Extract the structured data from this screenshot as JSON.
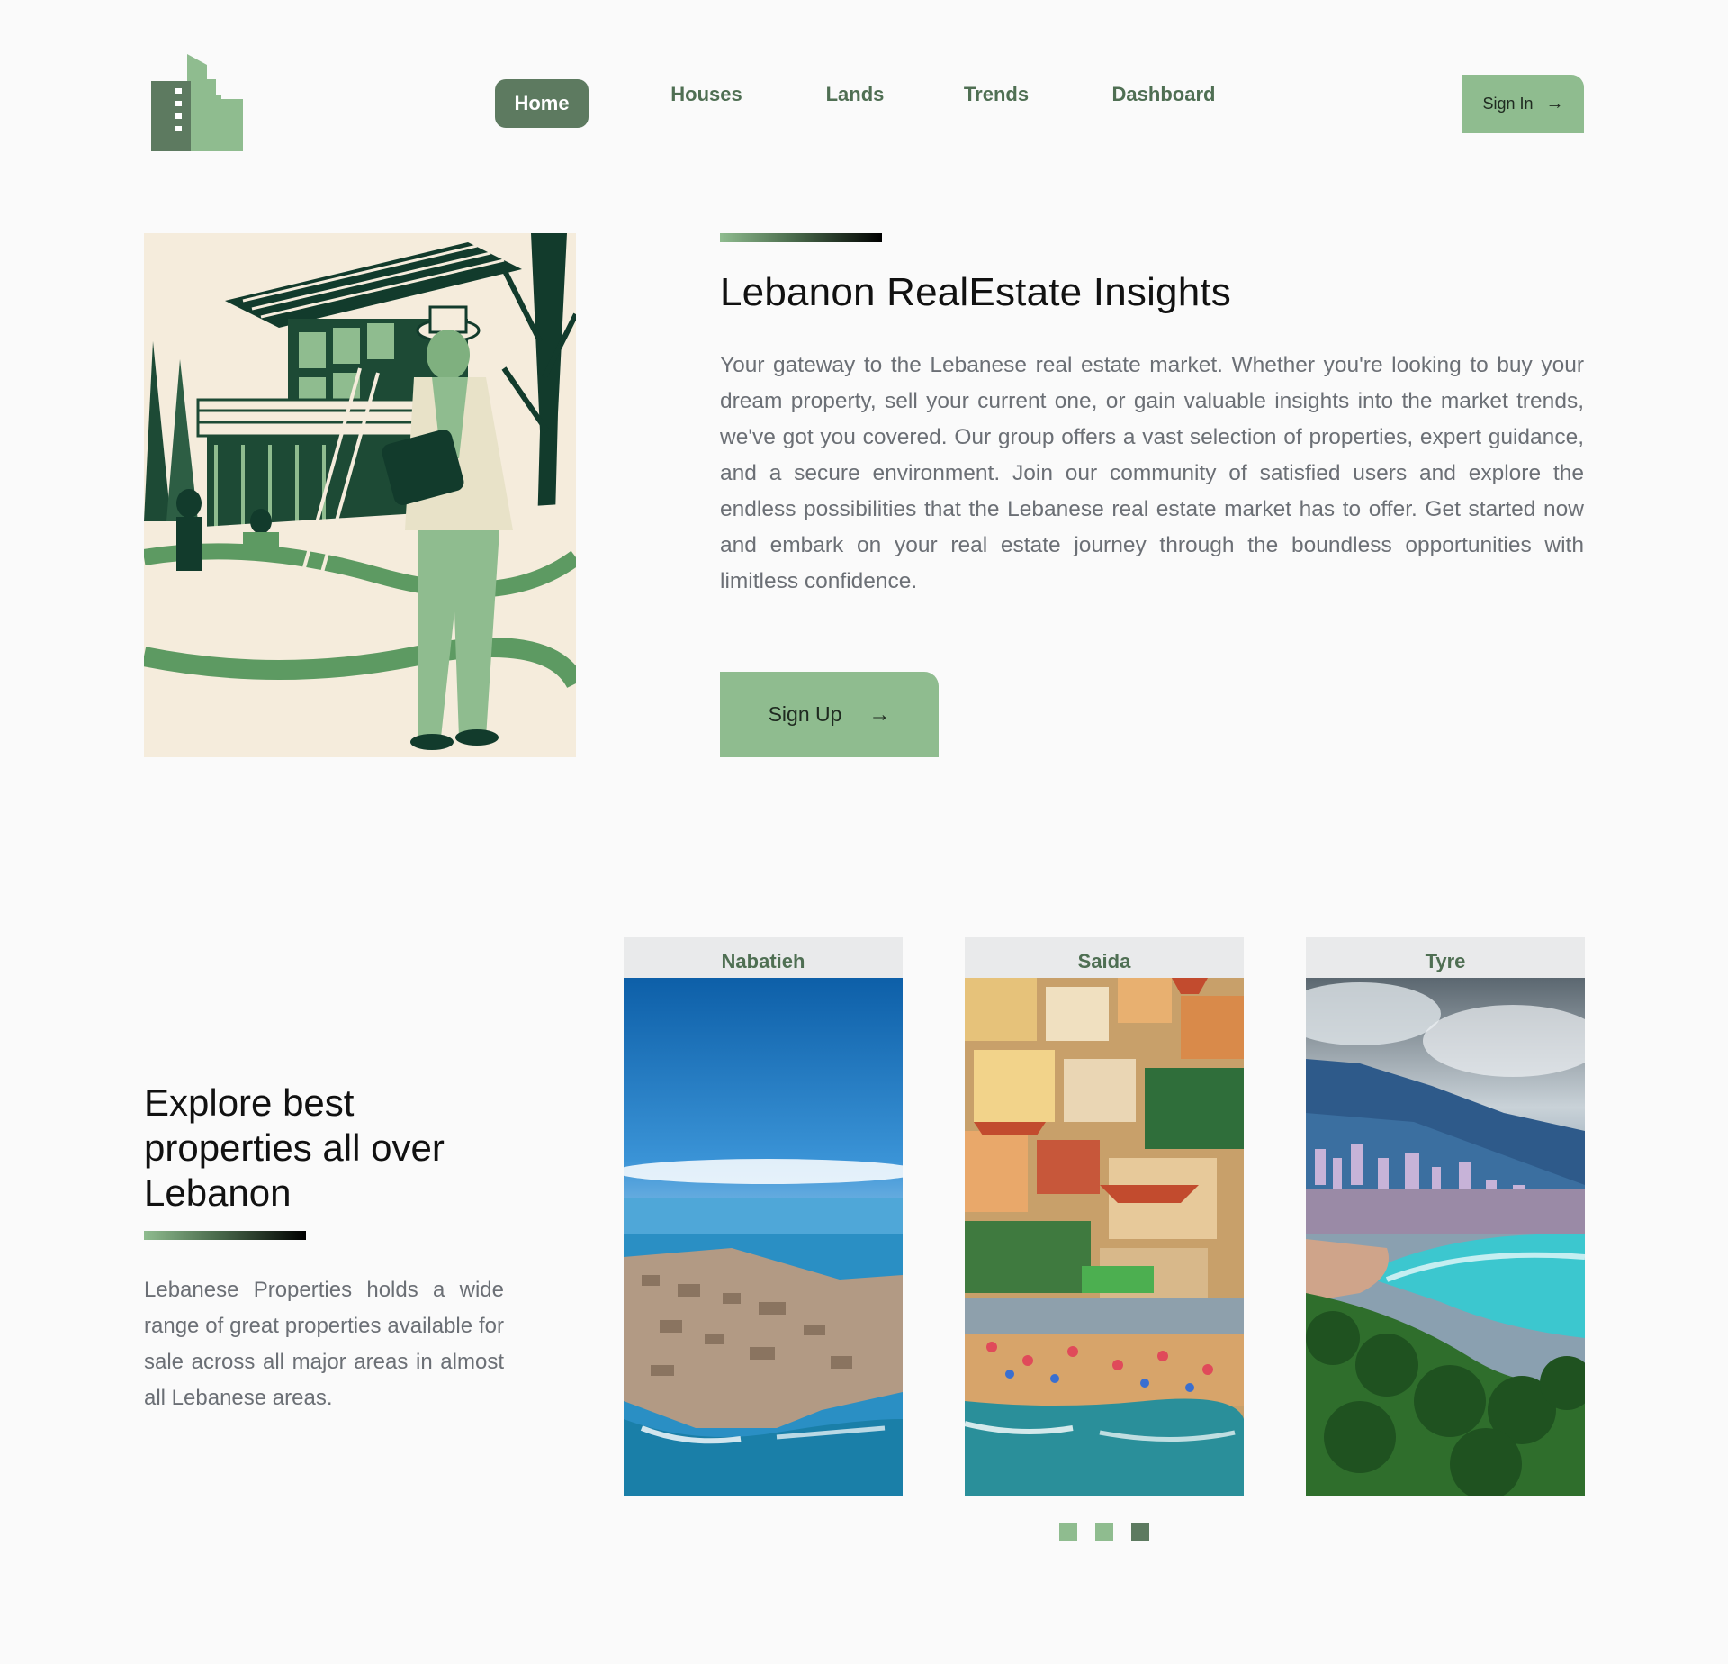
{
  "nav": {
    "items": [
      {
        "label": "Home",
        "active": true
      },
      {
        "label": "Houses",
        "active": false
      },
      {
        "label": "Lands",
        "active": false
      },
      {
        "label": "Trends",
        "active": false
      },
      {
        "label": "Dashboard",
        "active": false
      }
    ],
    "signin_label": "Sign In",
    "logo_icon": "buildings-logo-icon"
  },
  "hero": {
    "title": "Lebanon RealEstate Insights",
    "text": "Your gateway to the Lebanese real estate market. Whether you're looking to buy your dream property, sell your current one, or gain valuable insights into the market trends, we've got you covered. Our group offers a vast selection of properties, expert guidance, and a secure environment. Join our community of satisfied users and explore the endless possibilities that the Lebanese real estate market has to offer. Get started now and embark on your real estate journey through the boundless opportunities with limitless confidence.",
    "signup_label": "Sign Up",
    "arrow": "→"
  },
  "explore": {
    "title": "Explore best properties all over Lebanon",
    "text": "Lebanese Properties holds a wide range of great properties available for sale across all major areas in almost all Lebanese areas.",
    "cards": [
      {
        "label": "Nabatieh"
      },
      {
        "label": "Saida"
      },
      {
        "label": "Tyre"
      }
    ],
    "carousel_active_index": 2
  },
  "colors": {
    "accent": "#8fbc8f",
    "accent_dark": "#5d7a60",
    "nav_text": "#4f6f53",
    "body_text": "#6b6f75",
    "background": "#fafafa"
  }
}
